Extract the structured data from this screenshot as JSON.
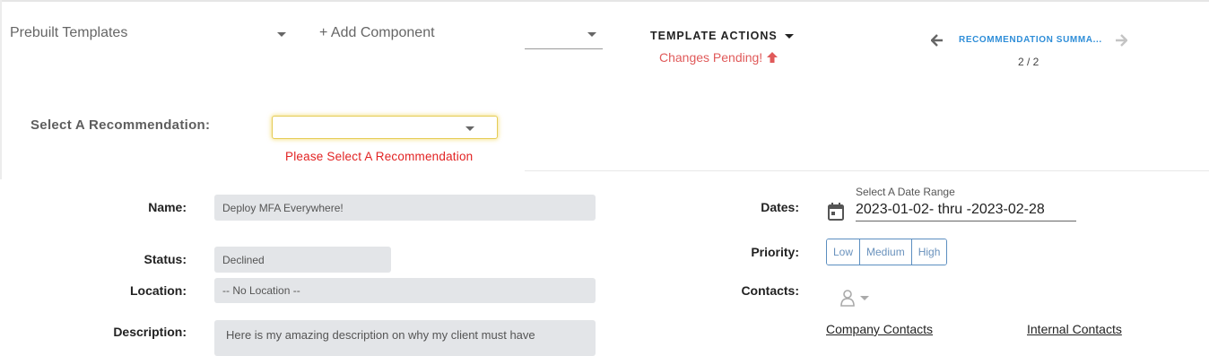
{
  "toolbar": {
    "prebuilt_templates": "Prebuilt Templates",
    "add_component": "+ Add Component",
    "template_actions": "TEMPLATE ACTIONS",
    "changes_pending": "Changes Pending!",
    "recommendation_summary": "RECOMMENDATION SUMMA...",
    "page_counter": "2 / 2"
  },
  "recommendation_select": {
    "label": "Select A Recommendation:",
    "value": "",
    "error": "Please Select A Recommendation"
  },
  "form": {
    "name_label": "Name:",
    "name_value": "Deploy MFA Everywhere!",
    "status_label": "Status:",
    "status_value": "Declined",
    "location_label": "Location:",
    "location_value": "-- No Location --",
    "description_label": "Description:",
    "description_value": "Here is my amazing description on why my client must have",
    "dates_label": "Dates:",
    "date_range_caption": "Select A Date Range",
    "date_range_value": "2023-01-02- thru -2023-02-28",
    "priority_label": "Priority:",
    "priority_options": [
      "Low",
      "Medium",
      "High"
    ],
    "contacts_label": "Contacts:",
    "company_contacts": "Company Contacts",
    "internal_contacts": "Internal Contacts"
  },
  "colors": {
    "accent_blue": "#2f8ed8",
    "pending_red": "#e05a5a",
    "error_red": "#e22323",
    "priority_border": "#5b8ec0",
    "field_bg": "#e3e5e8"
  },
  "icons": [
    "caret-down-icon",
    "arrow-up-icon",
    "arrow-left-icon",
    "arrow-right-icon",
    "calendar-icon",
    "contact-person-icon"
  ]
}
